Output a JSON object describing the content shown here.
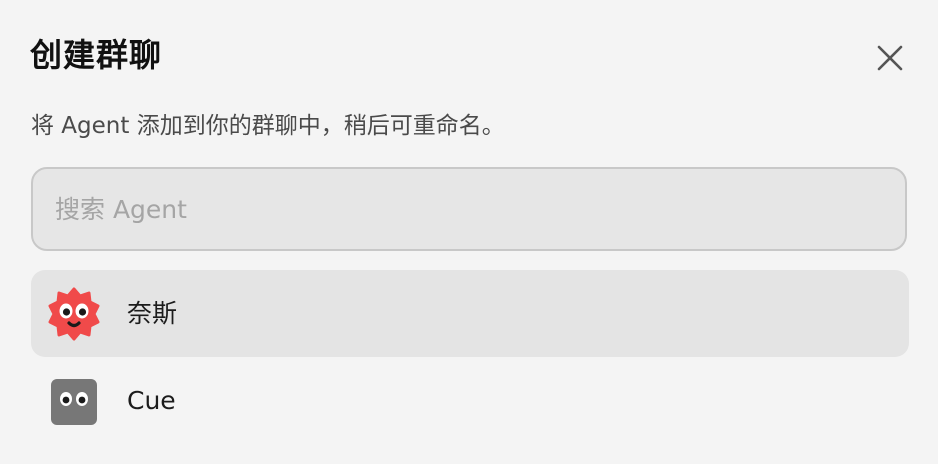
{
  "dialog": {
    "title": "创建群聊",
    "subtitle": "将 Agent 添加到你的群聊中，稍后可重命名。",
    "close_icon": "close-icon"
  },
  "search": {
    "placeholder": "搜索 Agent",
    "value": ""
  },
  "agents": [
    {
      "name": "奈斯",
      "avatar": "red-flower-face-icon",
      "color": "#f04a4a",
      "selected": true
    },
    {
      "name": "Cue",
      "avatar": "gray-square-eyes-icon",
      "color": "#777777",
      "selected": false
    }
  ],
  "colors": {
    "background": "#f4f4f4",
    "selected_row": "#e4e4e4",
    "search_bg": "#e6e6e6",
    "search_border": "#c8c8c8"
  }
}
